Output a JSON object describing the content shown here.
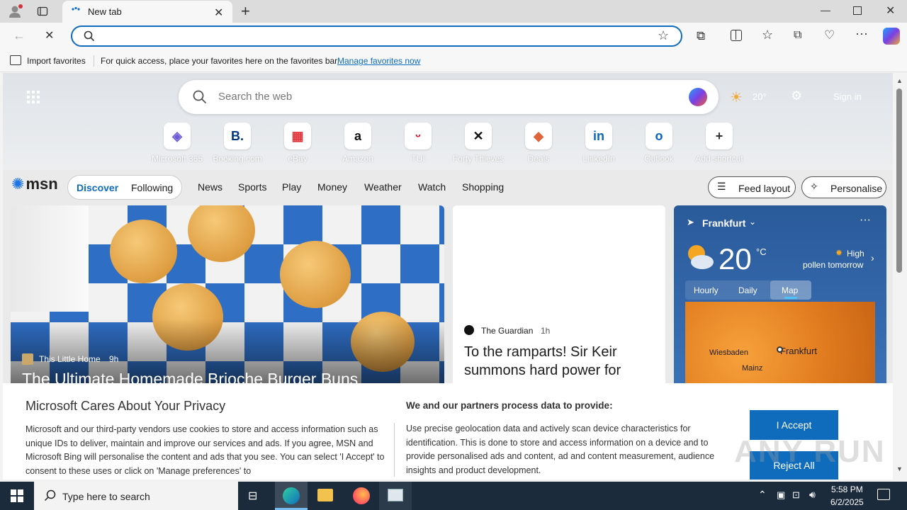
{
  "browser": {
    "tab_title": "New tab",
    "address_placeholder": "",
    "import_favorites": "Import favorites",
    "favbar_hint": "For quick access, place your favorites here on the favorites bar.",
    "manage_favorites": "Manage favorites now"
  },
  "newtab": {
    "search_placeholder": "Search the web",
    "weather_temp_small": "20°",
    "sign_in": "Sign in",
    "shortcuts": [
      {
        "label": "Microsoft 365",
        "glyph": "◈",
        "color": "#6b5bd6"
      },
      {
        "label": "Booking.com",
        "glyph": "B.",
        "color": "#003580"
      },
      {
        "label": "eBay",
        "glyph": "▦",
        "color": "#e53238"
      },
      {
        "label": "Amazon",
        "glyph": "a",
        "color": "#111111"
      },
      {
        "label": "TUI",
        "glyph": "ᵕ",
        "color": "#e2001a"
      },
      {
        "label": "Forty Thieves",
        "glyph": "✕",
        "color": "#111111"
      },
      {
        "label": "Deals",
        "glyph": "◆",
        "color": "#e0643a"
      },
      {
        "label": "LinkedIn",
        "glyph": "in",
        "color": "#0a66c2"
      },
      {
        "label": "Outlook",
        "glyph": "o",
        "color": "#0a64c2"
      },
      {
        "label": "Add shortcut",
        "glyph": "+",
        "color": "#333333"
      }
    ]
  },
  "msn": {
    "logo": "msn",
    "discover": "Discover",
    "following": "Following",
    "nav": [
      "News",
      "Sports",
      "Play",
      "Money",
      "Weather",
      "Watch",
      "Shopping"
    ],
    "feed_layout": "Feed layout",
    "personalise": "Personalise"
  },
  "cards": {
    "hero": {
      "source": "This Little Home",
      "time": "9h",
      "title": "The Ultimate Homemade Brioche Burger Buns"
    },
    "news": {
      "source": "The Guardian",
      "time": "1h",
      "title": "To the ramparts! Sir Keir summons hard power for"
    }
  },
  "weather": {
    "location": "Frankfurt",
    "temp": "20",
    "unit": "°C",
    "pollen_line1": "High",
    "pollen_line2": "pollen tomorrow",
    "tabs": [
      "Hourly",
      "Daily",
      "Map"
    ],
    "active_tab": "Map",
    "map_labels": [
      "Wiesbaden",
      "Frankfurt",
      "Mainz"
    ]
  },
  "privacy": {
    "title": "Microsoft Cares About Your Privacy",
    "body": "Microsoft and our third-party vendors use cookies to store and access information such as unique IDs to deliver, maintain and improve our services and ads. If you agree, MSN and Microsoft Bing will personalise the content and ads that you see. You can select 'I Accept' to consent to these uses or click on 'Manage preferences' to",
    "partners_title": "We and our partners process data to provide:",
    "partners_body": "Use precise geolocation data and actively scan device characteristics for identification. This is done to store and access information on a device and to provide personalised ads and content, ad and content measurement, audience insights and product development.",
    "accept": "I Accept",
    "reject": "Reject All"
  },
  "taskbar": {
    "search_placeholder": "Type here to search",
    "time": "5:58 PM",
    "date": "6/2/2025"
  },
  "watermark": "ANY RUN",
  "colors": {
    "accent": "#0f6cbd",
    "taskbar": "#1b2b3c",
    "weather_card": "#2a5a9a"
  }
}
